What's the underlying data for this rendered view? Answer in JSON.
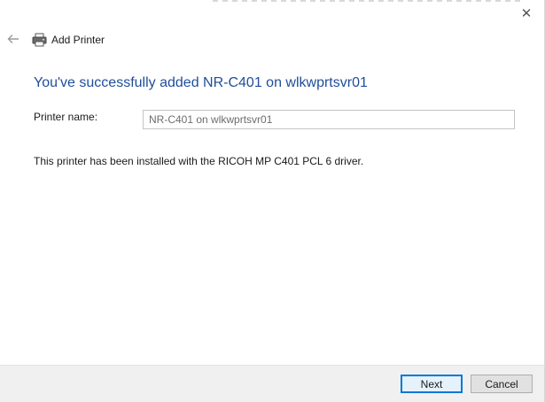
{
  "window": {
    "close_glyph": "✕",
    "back_icon": "back-arrow-icon",
    "printer_icon": "printer-icon",
    "title": "Add Printer"
  },
  "content": {
    "headline": "You've successfully added NR-C401 on wlkwprtsvr01",
    "printer_name_label": "Printer name:",
    "printer_name_value": "NR-C401 on wlkwprtsvr01",
    "info": "This printer has been installed with the RICOH MP C401 PCL 6 driver."
  },
  "footer": {
    "next_label": "Next",
    "cancel_label": "Cancel"
  },
  "colors": {
    "headline": "#1f4e9b",
    "default_button_border": "#0078d7"
  }
}
